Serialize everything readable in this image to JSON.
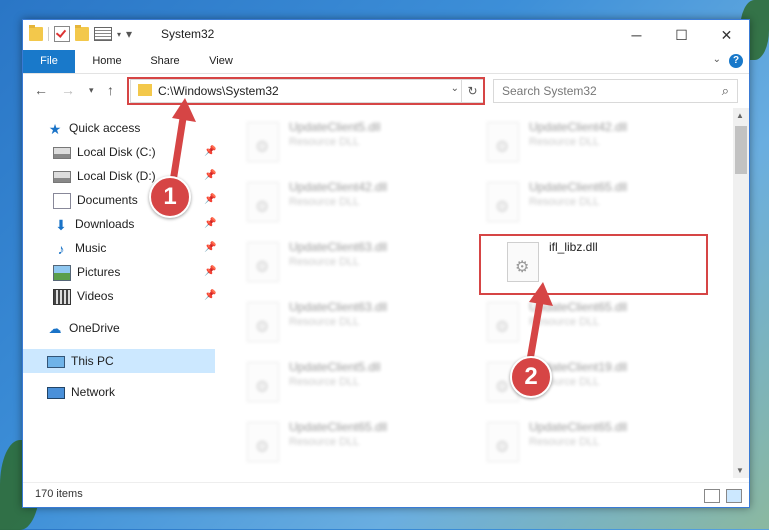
{
  "window": {
    "title": "System32"
  },
  "ribbon": {
    "tabs": [
      "File",
      "Home",
      "Share",
      "View"
    ]
  },
  "address": {
    "path": "C:\\Windows\\System32"
  },
  "search": {
    "placeholder": "Search System32"
  },
  "sidebar": {
    "items": [
      {
        "label": "Quick access"
      },
      {
        "label": "Local Disk (C:)"
      },
      {
        "label": "Local Disk (D:)"
      },
      {
        "label": "Documents"
      },
      {
        "label": "Downloads"
      },
      {
        "label": "Music"
      },
      {
        "label": "Pictures"
      },
      {
        "label": "Videos"
      },
      {
        "label": "OneDrive"
      },
      {
        "label": "This PC"
      },
      {
        "label": "Network"
      }
    ]
  },
  "files": [
    {
      "name": "UpdateClient5.dll",
      "type": "Resource DLL"
    },
    {
      "name": "UpdateClient42.dll",
      "type": "Resource DLL"
    },
    {
      "name": "UpdateClient42.dll",
      "type": "Resource DLL"
    },
    {
      "name": "UpdateClient65.dll",
      "type": "Resource DLL"
    },
    {
      "name": "UpdateClient63.dll",
      "type": "Resource DLL"
    },
    {
      "name": "ifl_libz.dll",
      "type": ""
    },
    {
      "name": "UpdateClient63.dll",
      "type": "Resource DLL"
    },
    {
      "name": "UpdateClient65.dll",
      "type": "Resource DLL"
    },
    {
      "name": "UpdateClient5.dll",
      "type": "Resource DLL"
    },
    {
      "name": "UpdateClient19.dll",
      "type": "Resource DLL"
    },
    {
      "name": "UpdateClient65.dll",
      "type": "Resource DLL"
    },
    {
      "name": "UpdateClient65.dll",
      "type": "Resource DLL"
    }
  ],
  "status": {
    "item_count": "170 items"
  },
  "callouts": {
    "step1": "1",
    "step2": "2"
  },
  "colors": {
    "accent": "#1979ca",
    "highlight": "#d64545"
  }
}
